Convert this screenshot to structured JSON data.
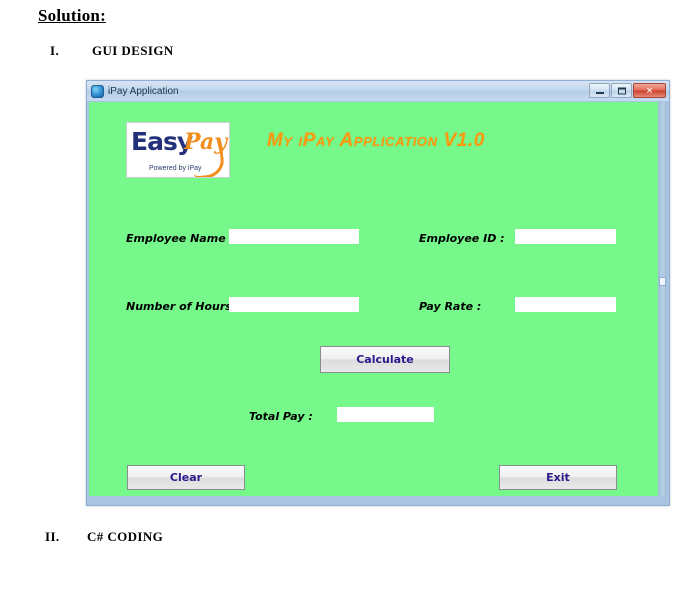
{
  "document": {
    "heading": "Solution:",
    "sections": [
      {
        "numeral": "I.",
        "label": "GUI DESIGN"
      },
      {
        "numeral": "II.",
        "label": "C# CODING"
      }
    ]
  },
  "window": {
    "title": "iPay Application",
    "icon": "app-icon",
    "controls": {
      "minimize": "minimize-icon",
      "maximize": "maximize-icon",
      "close": "✕"
    }
  },
  "form": {
    "app_title": "My iPay Application V1.0",
    "logo": {
      "primary": "Easy",
      "secondary": "Pay",
      "tagline": "Powered by iPay"
    },
    "fields": [
      {
        "label": "Employee Name :",
        "value": "",
        "placeholder": ""
      },
      {
        "label": "Employee ID :",
        "value": "",
        "placeholder": ""
      },
      {
        "label": "Number of Hours :",
        "value": "",
        "placeholder": ""
      },
      {
        "label": "Pay Rate :",
        "value": "",
        "placeholder": ""
      },
      {
        "label": "Total Pay :",
        "value": "",
        "placeholder": ""
      }
    ],
    "buttons": {
      "calculate": "Calculate",
      "clear": "Clear",
      "exit": "Exit"
    }
  },
  "colors": {
    "form_background": "#76f98a",
    "app_title": "#ff9a10",
    "logo_primary": "#23307a",
    "logo_secondary": "#f28f1c",
    "button_text": "#2b1a8c",
    "window_frame": "#a8c4e0"
  }
}
